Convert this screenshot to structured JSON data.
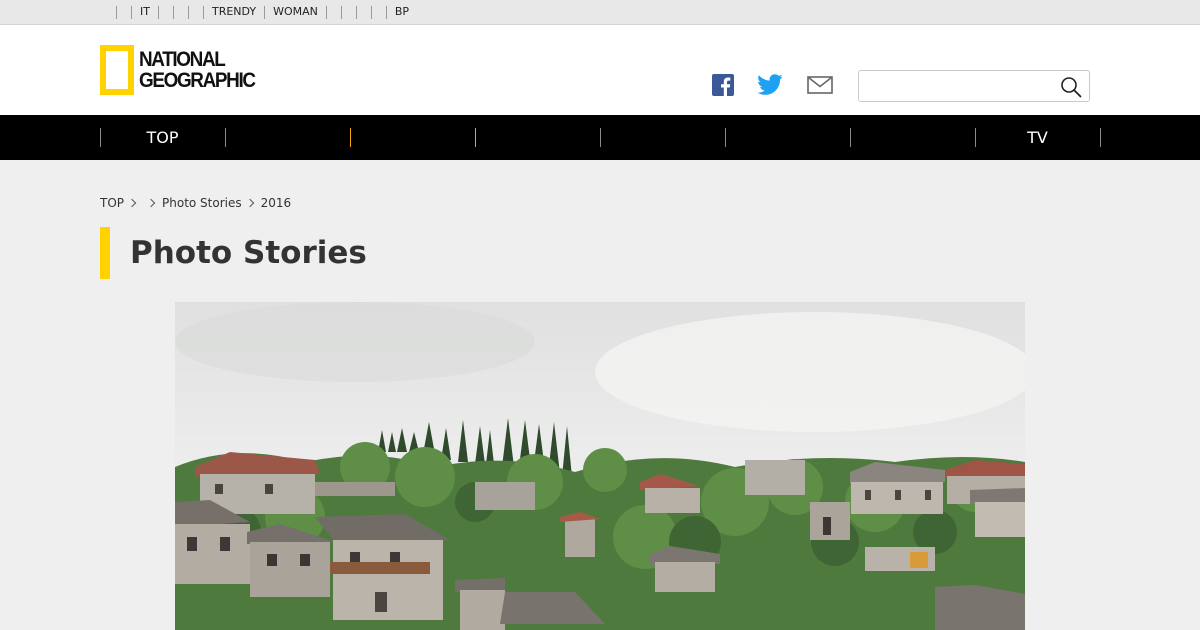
{
  "topbar": {
    "links": [
      "",
      "IT",
      "",
      "",
      "",
      "TRENDY",
      "WOMAN",
      "",
      "",
      "",
      "",
      "BP"
    ]
  },
  "header": {
    "logo": {
      "line1": "NATIONAL",
      "line2": "GEOGRAPHIC",
      "frame_color": "#ffd200"
    },
    "social": [
      "facebook-icon",
      "twitter-icon",
      "mail-icon"
    ],
    "search": {
      "value": "",
      "placeholder": ""
    }
  },
  "nav": {
    "items": [
      "TOP",
      "",
      "",
      "",
      "",
      "",
      "",
      "TV"
    ]
  },
  "breadcrumb": {
    "items": [
      "TOP",
      "",
      "Photo Stories",
      "2016"
    ]
  },
  "page": {
    "title": "Photo Stories",
    "accent_color": "#ffd200"
  },
  "hero": {
    "image": "hillside-stone-village-photo"
  }
}
